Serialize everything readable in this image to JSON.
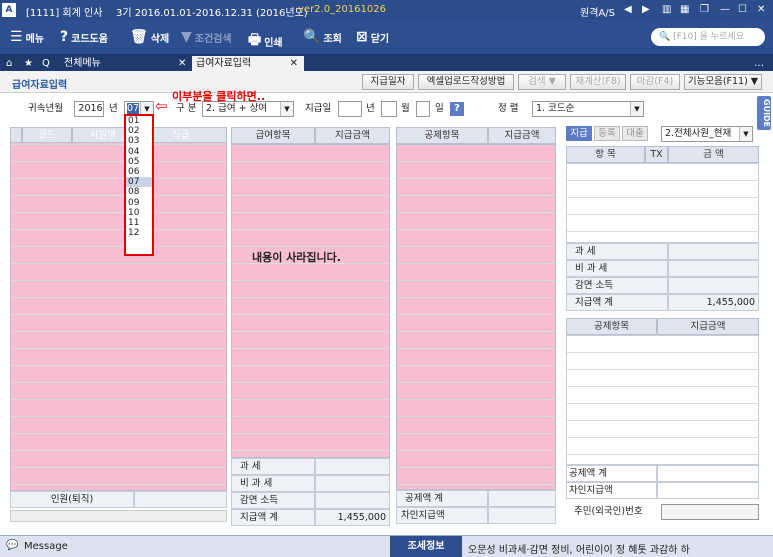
{
  "titlebar": {
    "company": "[1111] 회계 인사",
    "period": "3기 2016.01.01-2016.12.31 (2016년도)",
    "version": "ver2.0_20161026",
    "remote": "원격A/S"
  },
  "toolbar": {
    "menu": "메뉴",
    "code_help": "코드도움",
    "delete": "삭제",
    "condition_search": "조건검색",
    "print": "인쇄",
    "lookup": "조회",
    "close": "닫기",
    "search_placeholder": "[F10] 을 누르세요"
  },
  "tabs": {
    "all_menu": "전체메뉴",
    "current": "급여자료입력"
  },
  "header": {
    "title": "급여자료입력",
    "buttons": [
      "지급일자",
      "엑셀업로드작성방법",
      "검색 ▼",
      "재계산(F8)",
      "마감(F4)",
      "기능모음(F11) ▼"
    ]
  },
  "filter": {
    "year_label": "귀속년월",
    "year": "2016",
    "year_unit": "년",
    "month": "07",
    "month_unit": "월",
    "category_label": "구 분",
    "category": "2. 급여 + 상여",
    "payday_label": "지급일",
    "year_unit2": "년",
    "month_unit2": "월",
    "day_unit": "일",
    "sort_label": "정 렬",
    "sort": "1. 코드순"
  },
  "dropdown": {
    "months": [
      "01",
      "02",
      "03",
      "04",
      "05",
      "06",
      "07",
      "08",
      "09",
      "10",
      "11",
      "12"
    ],
    "selected": "07"
  },
  "annotation": {
    "text": "이부분을 클릭하면..",
    "result": "내용이 사라집니다."
  },
  "emp_grid": {
    "headers": [
      "코드",
      "사원명",
      "직급"
    ],
    "footer": "인원(퇴직)"
  },
  "pay_grid": {
    "headers": [
      "급여항목",
      "지급금액"
    ],
    "summary": [
      "과 세",
      "비 과 세",
      "감면 소득",
      "지급액 계"
    ],
    "total": "1,455,000"
  },
  "ded_grid": {
    "headers": [
      "공제항목",
      "지급금액"
    ],
    "summary": [
      "공제액 계",
      "차인지급액"
    ]
  },
  "right_panel": {
    "tabs": [
      "지급",
      "등록",
      "대출"
    ],
    "employee_filter": "2.전체사원_현재",
    "headers": [
      "항 목",
      "TX",
      "금 액"
    ],
    "summary": [
      "과 세",
      "비 과 세",
      "감면 소득",
      "지급액 계"
    ],
    "total": "1,455,000",
    "ded_headers": [
      "공제항목",
      "지급금액"
    ],
    "ded_summary": [
      "공제액 계",
      "차인지급액"
    ],
    "resident_label": "주민(외국인)번호"
  },
  "guide": "GUIDE",
  "status": {
    "message": "Message",
    "info_label": "조세정보",
    "info_text": "오문성 비과세·감면 정비, 어린이이 정 혜톳 과감하 하"
  }
}
